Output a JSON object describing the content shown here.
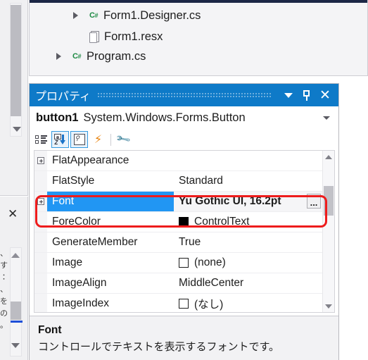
{
  "solution_tree": {
    "items": [
      {
        "label": "Form1.Designer.cs",
        "icon": "csharp-icon",
        "has_chevron": true,
        "indent": 62
      },
      {
        "label": "Form1.resx",
        "icon": "document-icon",
        "has_chevron": false,
        "indent": 62
      },
      {
        "label": "Program.cs",
        "icon": "csharp-icon",
        "has_chevron": true,
        "indent": 38
      }
    ]
  },
  "properties_window": {
    "title": "プロパティ",
    "titlebar_buttons": [
      {
        "name": "window-menu-chevron",
        "glyph": "▼"
      },
      {
        "name": "auto-hide-pin",
        "glyph": "pin"
      },
      {
        "name": "close",
        "glyph": "✕"
      }
    ],
    "object_selector": {
      "object_name": "button1",
      "object_type": "System.Windows.Forms.Button",
      "dropdown_glyph": "▼"
    },
    "toolbar": [
      {
        "name": "categorized-button",
        "icon": "categorized-icon",
        "selected": false,
        "tooltip": "Categorized"
      },
      {
        "name": "alphabetical-button",
        "icon": "alphabetical-az-icon",
        "selected": true,
        "tooltip": "Alphabetical"
      },
      {
        "name": "properties-page-button",
        "icon": "property-page-icon",
        "selected": true,
        "tooltip": "Properties"
      },
      {
        "name": "events-button",
        "icon": "lightning-bolt-icon",
        "selected": false,
        "tooltip": "Events"
      },
      {
        "name": "property-pages-button",
        "icon": "wrench-icon",
        "selected": false,
        "tooltip": "Property Pages"
      }
    ],
    "grid": {
      "rows": [
        {
          "name": "FlatAppearance",
          "value": "",
          "expandable": true,
          "selected": false,
          "swatch": null,
          "ellipsis": false
        },
        {
          "name": "FlatStyle",
          "value": "Standard",
          "expandable": false,
          "selected": false,
          "swatch": null,
          "ellipsis": false
        },
        {
          "name": "Font",
          "value": "Yu Gothic UI, 16.2pt",
          "expandable": true,
          "selected": true,
          "swatch": null,
          "ellipsis": true,
          "ellipsis_label": "..."
        },
        {
          "name": "ForeColor",
          "value": "ControlText",
          "expandable": false,
          "selected": false,
          "swatch": "#000000",
          "ellipsis": false
        },
        {
          "name": "GenerateMember",
          "value": "True",
          "expandable": false,
          "selected": false,
          "swatch": null,
          "ellipsis": false
        },
        {
          "name": "Image",
          "value": "(none)",
          "expandable": false,
          "selected": false,
          "swatch": "empty",
          "ellipsis": false
        },
        {
          "name": "ImageAlign",
          "value": "MiddleCenter",
          "expandable": false,
          "selected": false,
          "swatch": null,
          "ellipsis": false
        },
        {
          "name": "ImageIndex",
          "value": "(なし)",
          "expandable": false,
          "selected": false,
          "swatch": "empty",
          "ellipsis": false
        }
      ]
    },
    "description": {
      "title": "Font",
      "text": "コントロールでテキストを表示するフォントです。"
    }
  },
  "left_strip": {
    "close_glyph": "✕",
    "text_fragments": "、 す ： 、 を の 。"
  },
  "colors": {
    "titlebar_blue": "#0e7ac8",
    "selection_blue": "#2196f3",
    "annotation_red": "#ee1c1c",
    "csharp_green": "#1d8a43",
    "bolt_orange": "#e8820c",
    "blue_underline": "#1e4fd8"
  }
}
